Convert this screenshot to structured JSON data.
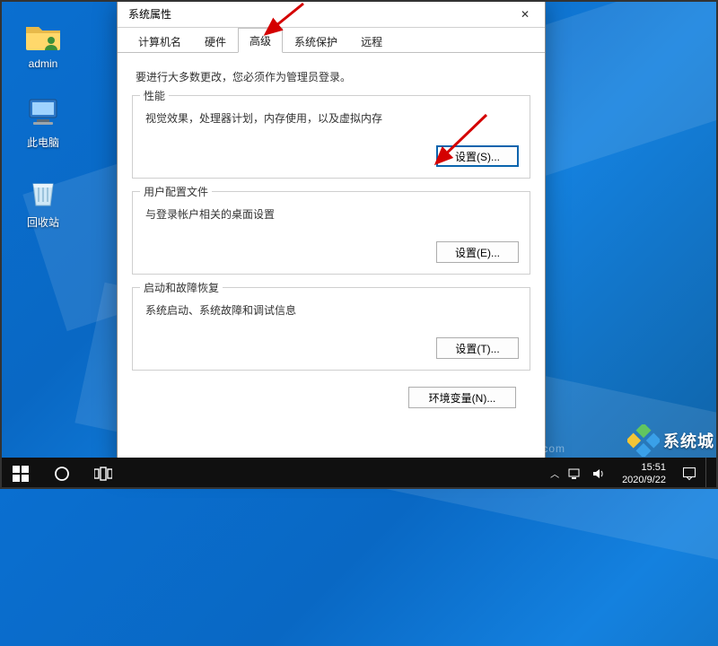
{
  "desktop": {
    "icons": [
      {
        "label": "admin"
      },
      {
        "label": "此电脑"
      },
      {
        "label": "回收站"
      }
    ]
  },
  "dialog": {
    "title": "系统属性",
    "close_glyph": "✕",
    "tabs": [
      {
        "label": "计算机名"
      },
      {
        "label": "硬件"
      },
      {
        "label": "高级"
      },
      {
        "label": "系统保护"
      },
      {
        "label": "远程"
      }
    ],
    "active_tab_index": 2,
    "hint": "要进行大多数更改，您必须作为管理员登录。",
    "groups": {
      "performance": {
        "legend": "性能",
        "desc": "视觉效果，处理器计划，内存使用，以及虚拟内存",
        "button": "设置(S)..."
      },
      "profiles": {
        "legend": "用户配置文件",
        "desc": "与登录帐户相关的桌面设置",
        "button": "设置(E)..."
      },
      "startup": {
        "legend": "启动和故障恢复",
        "desc": "系统启动、系统故障和调试信息",
        "button": "设置(T)..."
      }
    },
    "env_button": "环境变量(N)..."
  },
  "taskbar": {
    "time": "15:51",
    "date": "2020/9/22"
  },
  "watermark": {
    "brand": "系统城",
    "faint": "neng.com"
  }
}
